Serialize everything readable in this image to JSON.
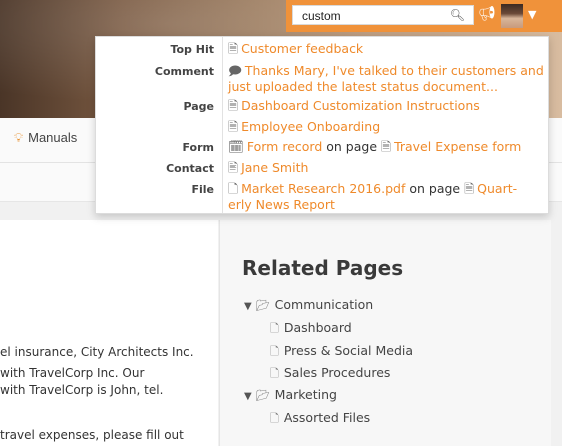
{
  "search": {
    "value": "custom",
    "icon": "search-icon"
  },
  "header": {
    "notification_icon": "megaphone-icon",
    "user_menu_icon": "chevron-down-icon"
  },
  "nav": {
    "manuals_label": "Manuals"
  },
  "dropdown": {
    "top_hit": {
      "category": "Top Hit",
      "text": "Customer feedback"
    },
    "comment": {
      "category": "Comment",
      "text": "Thanks Mary, I've talked to their customers and",
      "text_cont": "just uploaded the latest status document..."
    },
    "page": {
      "category": "Page",
      "items": [
        "Dashboard Customization Instructions",
        "Employee Onboarding"
      ]
    },
    "form": {
      "category": "Form",
      "text": "Form record",
      "on_page": "on page",
      "page_text": "Travel Expense form"
    },
    "contact": {
      "category": "Contact",
      "text": "Jane Smith"
    },
    "file": {
      "category": "File",
      "text": "Market Research 2016.pdf",
      "on_page": "on page",
      "page_text": "Quart-",
      "page_text_cont": "erly News Report"
    }
  },
  "content": {
    "lines": [
      "el insurance, City Architects Inc.",
      " with TravelCorp Inc. Our",
      " with TravelCorp is John, tel.",
      " travel expenses, please fill out"
    ]
  },
  "sidebar": {
    "title": "Related Pages",
    "groups": [
      {
        "label": "Communication",
        "items": [
          "Dashboard",
          "Press & Social Media",
          "Sales Procedures"
        ]
      },
      {
        "label": "Marketing",
        "items": [
          "Assorted Files"
        ]
      }
    ]
  }
}
